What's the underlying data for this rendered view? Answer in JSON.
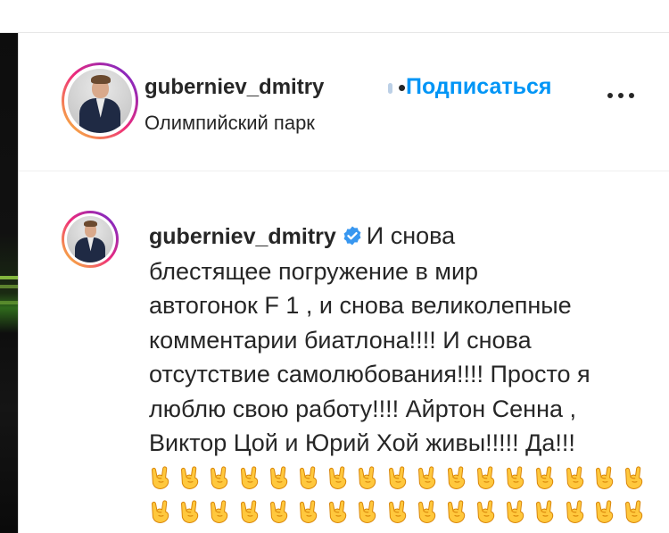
{
  "post_header": {
    "username": "guberniev_dmitry",
    "separator": "•",
    "follow_label": "Подписаться",
    "location": "Олимпийский парк",
    "more_icon": "more-horizontal-icon"
  },
  "comment": {
    "username": "guberniev_dmitry",
    "verified_icon": "verified-badge-icon",
    "text_lines": [
      "И снова",
      "блестящее погружение в мир",
      "автогонок F 1 , и снова великолепные",
      "комментарии биатлона!!!! И снова",
      "отсутствие самолюбования!!!! Просто я",
      "люблю свою работу!!!! Айртон Сенна ,",
      "Виктор Цой и Юрий Хой живы!!!!! Да!!!"
    ],
    "emoji": {
      "name": "sign-of-the-horns-emoji",
      "rows": [
        17,
        17
      ]
    }
  },
  "colors": {
    "accent": "#0095f6",
    "text": "#262626",
    "verified": "#3897f0",
    "emoji": "#ffc83d"
  }
}
